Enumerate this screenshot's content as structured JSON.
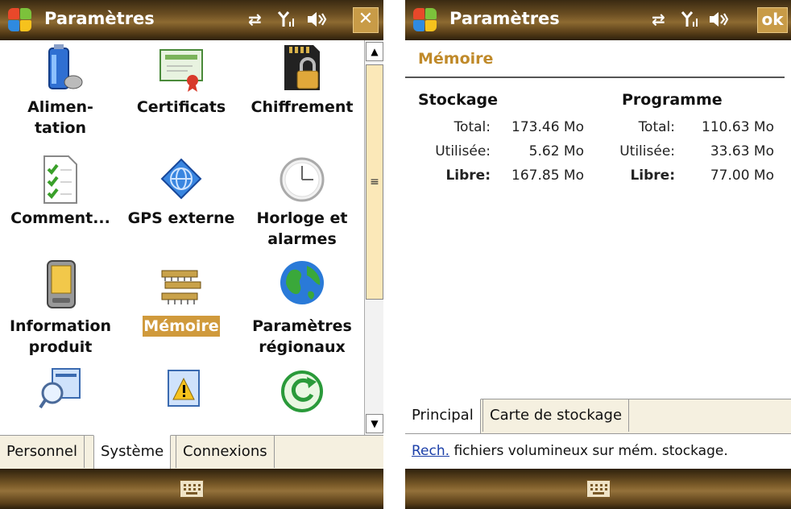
{
  "left": {
    "title": "Paramètres",
    "close_label": "✕",
    "items": [
      {
        "label": "Alimen-\ntation",
        "icon": "battery-icon"
      },
      {
        "label": "Certificats",
        "icon": "certificate-icon"
      },
      {
        "label": "Chiffrement",
        "icon": "encryption-lock-icon"
      },
      {
        "label": "Comment...",
        "icon": "checklist-icon"
      },
      {
        "label": "GPS externe",
        "icon": "gps-globe-icon"
      },
      {
        "label": "Horloge et\nalarmes",
        "icon": "clock-icon"
      },
      {
        "label": "Information\nproduit",
        "icon": "device-icon"
      },
      {
        "label": "Mémoire",
        "icon": "memory-chip-icon"
      },
      {
        "label": "Paramètres\nrégionaux",
        "icon": "earth-globe-icon"
      }
    ],
    "tabs": [
      "Personnel",
      "Système",
      "Connexions"
    ]
  },
  "right": {
    "title": "Paramètres",
    "ok_label": "ok",
    "heading": "Mémoire",
    "storage": {
      "header": "Stockage",
      "total_label": "Total:",
      "total": "173.46 Mo",
      "used_label": "Utilisée:",
      "used": "5.62 Mo",
      "free_label": "Libre:",
      "free": "167.85 Mo"
    },
    "program": {
      "header": "Programme",
      "total_label": "Total:",
      "total": "110.63 Mo",
      "used_label": "Utilisée:",
      "used": "33.63 Mo",
      "free_label": "Libre:",
      "free": "77.00 Mo"
    },
    "tabs": [
      "Principal",
      "Carte de stockage"
    ],
    "note_link": "Rech.",
    "note_text": " fichiers volumineux sur mém. stockage."
  },
  "colors": {
    "accent": "#d09a3c",
    "bar": "#6b4e22",
    "heading": "#c08a2a"
  }
}
